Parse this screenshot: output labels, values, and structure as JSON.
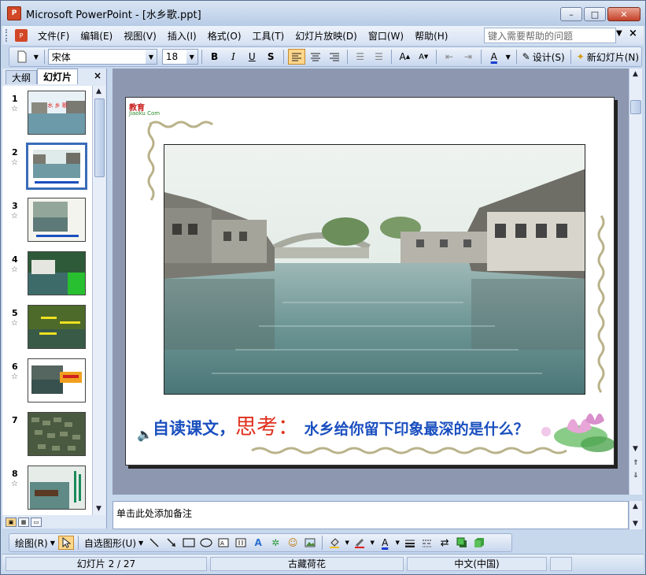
{
  "window": {
    "title": "Microsoft PowerPoint - [水乡歌.ppt]",
    "app_icon": "P",
    "minimize": "–",
    "maximize": "□",
    "close": "✕"
  },
  "menu": {
    "items": [
      "文件(F)",
      "编辑(E)",
      "视图(V)",
      "插入(I)",
      "格式(O)",
      "工具(T)",
      "幻灯片放映(D)",
      "窗口(W)",
      "帮助(H)"
    ],
    "help_placeholder": "键入需要帮助的问题",
    "close_doc": "×"
  },
  "toolbar": {
    "font": "宋体",
    "size": "18",
    "bold": "B",
    "italic": "I",
    "underline": "U",
    "shadow": "S",
    "design_label": "设计(S)",
    "new_slide_label": "新幻灯片(N)"
  },
  "left_pane": {
    "tabs": [
      "大纲",
      "幻灯片"
    ],
    "close": "×",
    "slide_numbers": [
      "1",
      "2",
      "3",
      "4",
      "5",
      "6",
      "7",
      "8"
    ],
    "selected_slide": 2
  },
  "slide": {
    "logo_text": "教育",
    "logo_sub": "Jiaoku Com",
    "caption_part1": "自读课文，",
    "caption_part2": "思考：",
    "caption_part3": " 水乡给你留下印象最深的是什么？"
  },
  "notes": {
    "placeholder": "单击此处添加备注"
  },
  "drawbar": {
    "draw_label": "绘图(R)",
    "autoshape_label": "自选图形(U)"
  },
  "status": {
    "slide_info": "幻灯片 2 / 27",
    "design": "古藏荷花",
    "language": "中文(中国)"
  },
  "colors": {
    "caption_blue": "#1a4fbf",
    "caption_red": "#e0301e",
    "selected_thumb_border": "#3a6cb8"
  }
}
